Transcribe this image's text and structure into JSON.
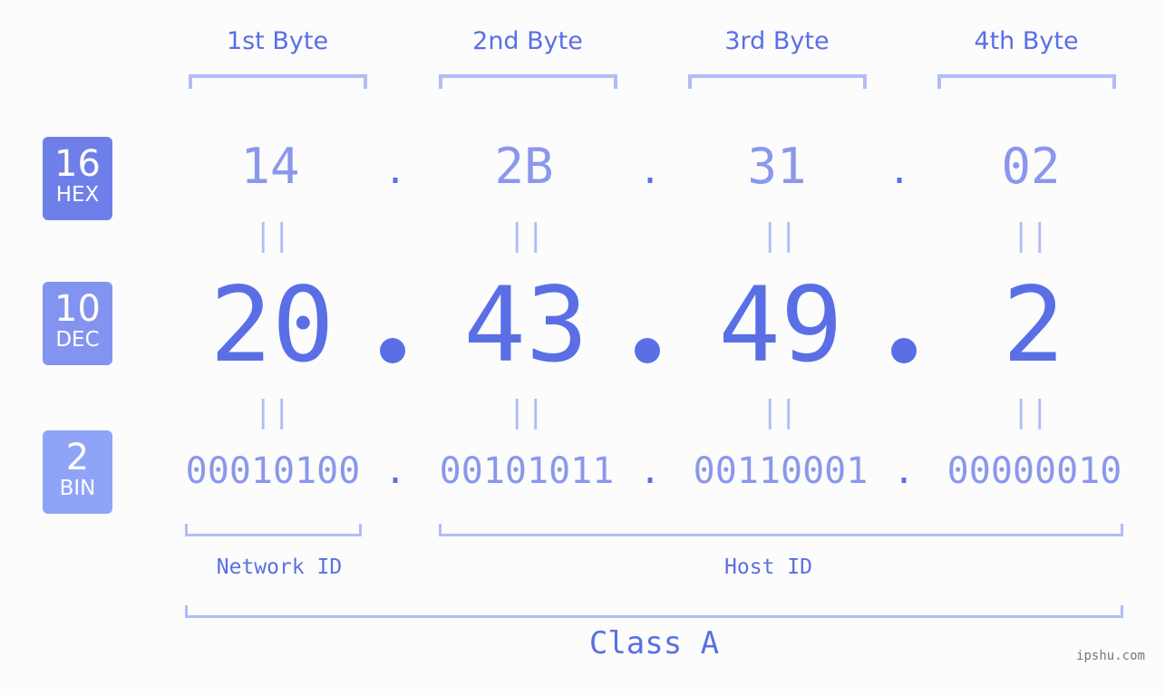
{
  "bytes": [
    {
      "label": "1st Byte",
      "hex": "14",
      "dec": "20",
      "bin": "00010100"
    },
    {
      "label": "2nd Byte",
      "hex": "2B",
      "dec": "43",
      "bin": "00101011"
    },
    {
      "label": "3rd Byte",
      "hex": "31",
      "dec": "49",
      "bin": "00110001"
    },
    {
      "label": "4th Byte",
      "hex": "02",
      "dec": "2",
      "bin": "00000010"
    }
  ],
  "separator": ".",
  "equals": "||",
  "badges": {
    "hex": {
      "num": "16",
      "name": "HEX",
      "color": "#6f7fe9"
    },
    "dec": {
      "num": "10",
      "name": "DEC",
      "color": "#8393f0"
    },
    "bin": {
      "num": "2",
      "name": "BIN",
      "color": "#8fa4f7"
    }
  },
  "network_id_label": "Network ID",
  "host_id_label": "Host ID",
  "class_label": "Class A",
  "watermark": "ipshu.com",
  "colors": {
    "primary": "#5a6fe6",
    "light": "#8a97ec",
    "bracket": "#b2bcf7"
  }
}
